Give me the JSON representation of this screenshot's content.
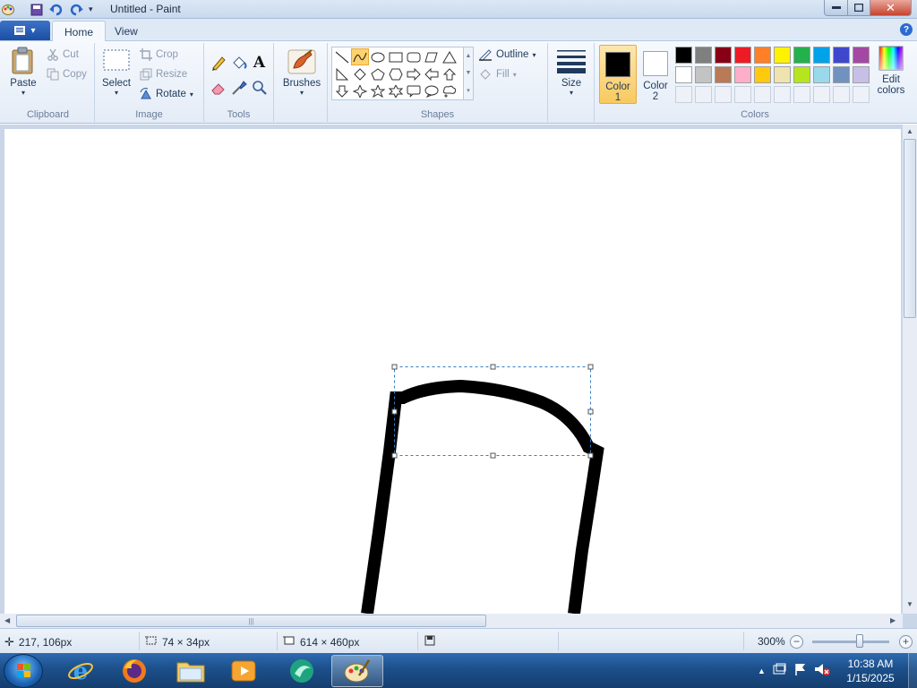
{
  "window": {
    "title": "Untitled - Paint"
  },
  "tabs": {
    "home": "Home",
    "view": "View"
  },
  "ribbon": {
    "clipboard": {
      "paste": "Paste",
      "cut": "Cut",
      "copy": "Copy",
      "label": "Clipboard"
    },
    "image": {
      "select": "Select",
      "crop": "Crop",
      "resize": "Resize",
      "rotate": "Rotate",
      "label": "Image"
    },
    "tools": {
      "label": "Tools",
      "items": [
        "pencil-icon",
        "fill-icon",
        "text-icon",
        "eraser-icon",
        "color-picker-icon",
        "magnifier-icon"
      ]
    },
    "brushes": {
      "label": "Brushes"
    },
    "shapes": {
      "label": "Shapes",
      "outline": "Outline",
      "fill": "Fill",
      "selected": "curve"
    },
    "size": {
      "label": "Size"
    },
    "colors": {
      "label": "Colors",
      "color1_line1": "Color",
      "color1_line2": "1",
      "color2_line1": "Color",
      "color2_line2": "2",
      "color1_value": "#000000",
      "color2_value": "#ffffff",
      "edit_line1": "Edit",
      "edit_line2": "colors",
      "palette_row1": [
        "#000000",
        "#7f7f7f",
        "#880015",
        "#ed1c24",
        "#ff7f27",
        "#fff200",
        "#22b14c",
        "#00a2e8",
        "#3f48cc",
        "#a349a4"
      ],
      "palette_row2": [
        "#ffffff",
        "#c3c3c3",
        "#b97a57",
        "#ffaec9",
        "#ffc90e",
        "#efe4b0",
        "#b5e61d",
        "#99d9ea",
        "#7092be",
        "#c8bfe7"
      ]
    }
  },
  "status": {
    "cursor_pos": "217, 106px",
    "selection_size": "74 × 34px",
    "image_size": "614 × 460px",
    "zoom": "300%"
  },
  "taskbar": {
    "time": "10:38 AM",
    "date": "1/15/2025"
  }
}
